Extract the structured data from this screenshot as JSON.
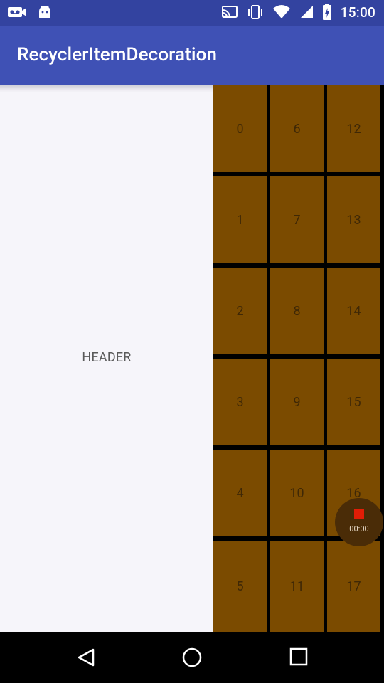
{
  "status_bar": {
    "time": "15:00"
  },
  "app_bar": {
    "title": "RecyclerItemDecoration"
  },
  "header": {
    "label": "HEADER"
  },
  "grid": {
    "columns": [
      [
        "0",
        "1",
        "2",
        "3",
        "4",
        "5"
      ],
      [
        "6",
        "7",
        "8",
        "9",
        "10",
        "11"
      ],
      [
        "12",
        "13",
        "14",
        "15",
        "16",
        "17"
      ]
    ]
  },
  "recorder": {
    "time": "00:00"
  },
  "colors": {
    "status_bar": "#3343a0",
    "app_bar": "#3f51b5",
    "cell": "#7b4b00",
    "cell_text": "#3f2806",
    "record": "#e21d06"
  }
}
